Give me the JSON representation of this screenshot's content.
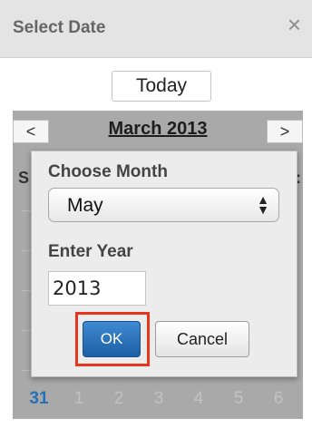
{
  "dialog": {
    "title": "Select Date",
    "close_icon": "close-icon",
    "close_glyph": "×"
  },
  "calendar": {
    "today_label": "Today",
    "prev_glyph": "<",
    "next_glyph": ">",
    "month_title": "March 2013",
    "week_hint_left": "S",
    "week_hint_right": ":",
    "last_row_days": [
      "31",
      "1",
      "2",
      "3",
      "4",
      "5",
      "6"
    ]
  },
  "popup": {
    "choose_month_label": "Choose Month",
    "month_value": "May",
    "enter_year_label": "Enter Year",
    "year_value": "2013",
    "ok_label": "OK",
    "cancel_label": "Cancel"
  },
  "colors": {
    "accent": "#2670b6",
    "highlight": "#e8361c"
  }
}
